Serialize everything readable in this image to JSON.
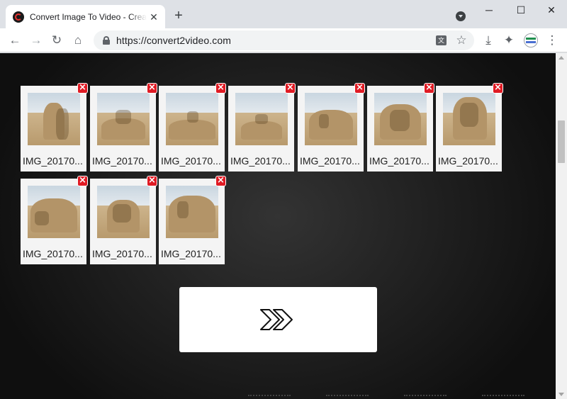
{
  "browser": {
    "tab": {
      "title": "Convert Image To Video - Create",
      "favicon": "c2v-logo-icon",
      "close_label": "✕"
    },
    "new_tab_label": "+",
    "window_controls": {
      "minimize": "─",
      "maximize": "☐",
      "close": "✕"
    },
    "toolbar": {
      "back": "←",
      "forward": "→",
      "reload": "↻",
      "home": "⌂",
      "url": "https://convert2video.com",
      "translate_label": "文",
      "star": "☆",
      "download": "⤓",
      "extensions": "✦",
      "menu": "⋮"
    },
    "colors": {
      "tabstrip": "#dee1e6",
      "toolbar": "#ffffff",
      "omnibox": "#f1f3f4"
    }
  },
  "page": {
    "colors": {
      "background": "#1f1f1f",
      "card": "#f4f4f4",
      "remove": "#e01b24",
      "next_button": "#ffffff"
    },
    "images": [
      {
        "name": "IMG_20170...",
        "thumb": "sand-sculpture-tower"
      },
      {
        "name": "IMG_20170...",
        "thumb": "sand-sculpture-figures"
      },
      {
        "name": "IMG_20170...",
        "thumb": "sand-sculpture-hill"
      },
      {
        "name": "IMG_20170...",
        "thumb": "sand-sculpture-low"
      },
      {
        "name": "IMG_20170...",
        "thumb": "sand-sculpture-scene"
      },
      {
        "name": "IMG_20170...",
        "thumb": "sand-sculpture-round"
      },
      {
        "name": "IMG_20170...",
        "thumb": "sand-sculpture-tall"
      },
      {
        "name": "IMG_20170...",
        "thumb": "sand-sculpture-cart"
      },
      {
        "name": "IMG_20170...",
        "thumb": "sand-sculpture-face"
      },
      {
        "name": "IMG_20170...",
        "thumb": "sand-sculpture-kids"
      }
    ],
    "remove_label": "×",
    "next_icon": "double-chevron-right-icon"
  }
}
